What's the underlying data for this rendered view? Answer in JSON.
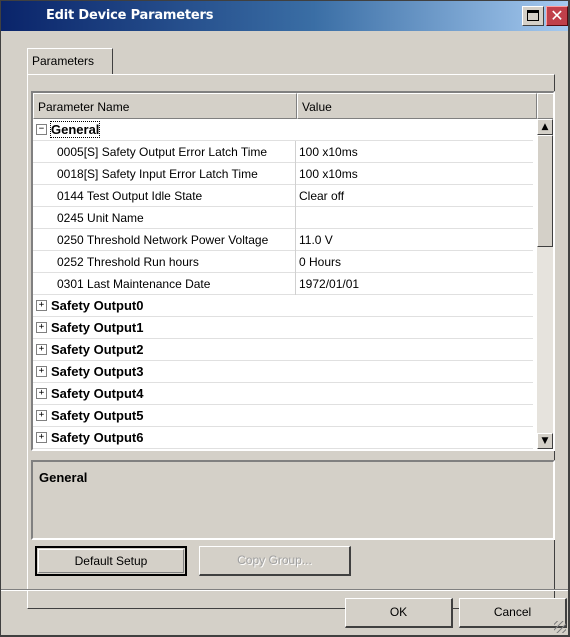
{
  "window": {
    "title": "Edit Device Parameters",
    "maximize_icon": "maximize-icon",
    "close_icon": "close-icon",
    "close_glyph": "✕"
  },
  "tabs": [
    {
      "label": "Parameters"
    }
  ],
  "list": {
    "columns": {
      "name": "Parameter Name",
      "value": "Value"
    },
    "expanded_group": {
      "label": "General",
      "expander": "−"
    },
    "rows": [
      {
        "name": "0005[S] Safety Output Error Latch Time",
        "value": "100 x10ms"
      },
      {
        "name": "0018[S] Safety Input Error Latch Time",
        "value": "100 x10ms"
      },
      {
        "name": "0144 Test Output Idle State",
        "value": "Clear off"
      },
      {
        "name": "0245 Unit Name",
        "value": ""
      },
      {
        "name": "0250 Threshold Network Power Voltage",
        "value": "11.0 V"
      },
      {
        "name": "0252 Threshold Run hours",
        "value": "0 Hours"
      },
      {
        "name": "0301 Last Maintenance Date",
        "value": "1972/01/01"
      }
    ],
    "collapsed_groups": [
      {
        "label": "Safety Output0",
        "expander": "+"
      },
      {
        "label": "Safety Output1",
        "expander": "+"
      },
      {
        "label": "Safety Output2",
        "expander": "+"
      },
      {
        "label": "Safety Output3",
        "expander": "+"
      },
      {
        "label": "Safety Output4",
        "expander": "+"
      },
      {
        "label": "Safety Output5",
        "expander": "+"
      },
      {
        "label": "Safety Output6",
        "expander": "+"
      }
    ],
    "scroll_up_glyph": "▲",
    "scroll_down_glyph": "▼"
  },
  "description": {
    "title": "General"
  },
  "buttons": {
    "default_setup": "Default Setup",
    "copy_group": "Copy Group...",
    "ok": "OK",
    "cancel": "Cancel"
  }
}
